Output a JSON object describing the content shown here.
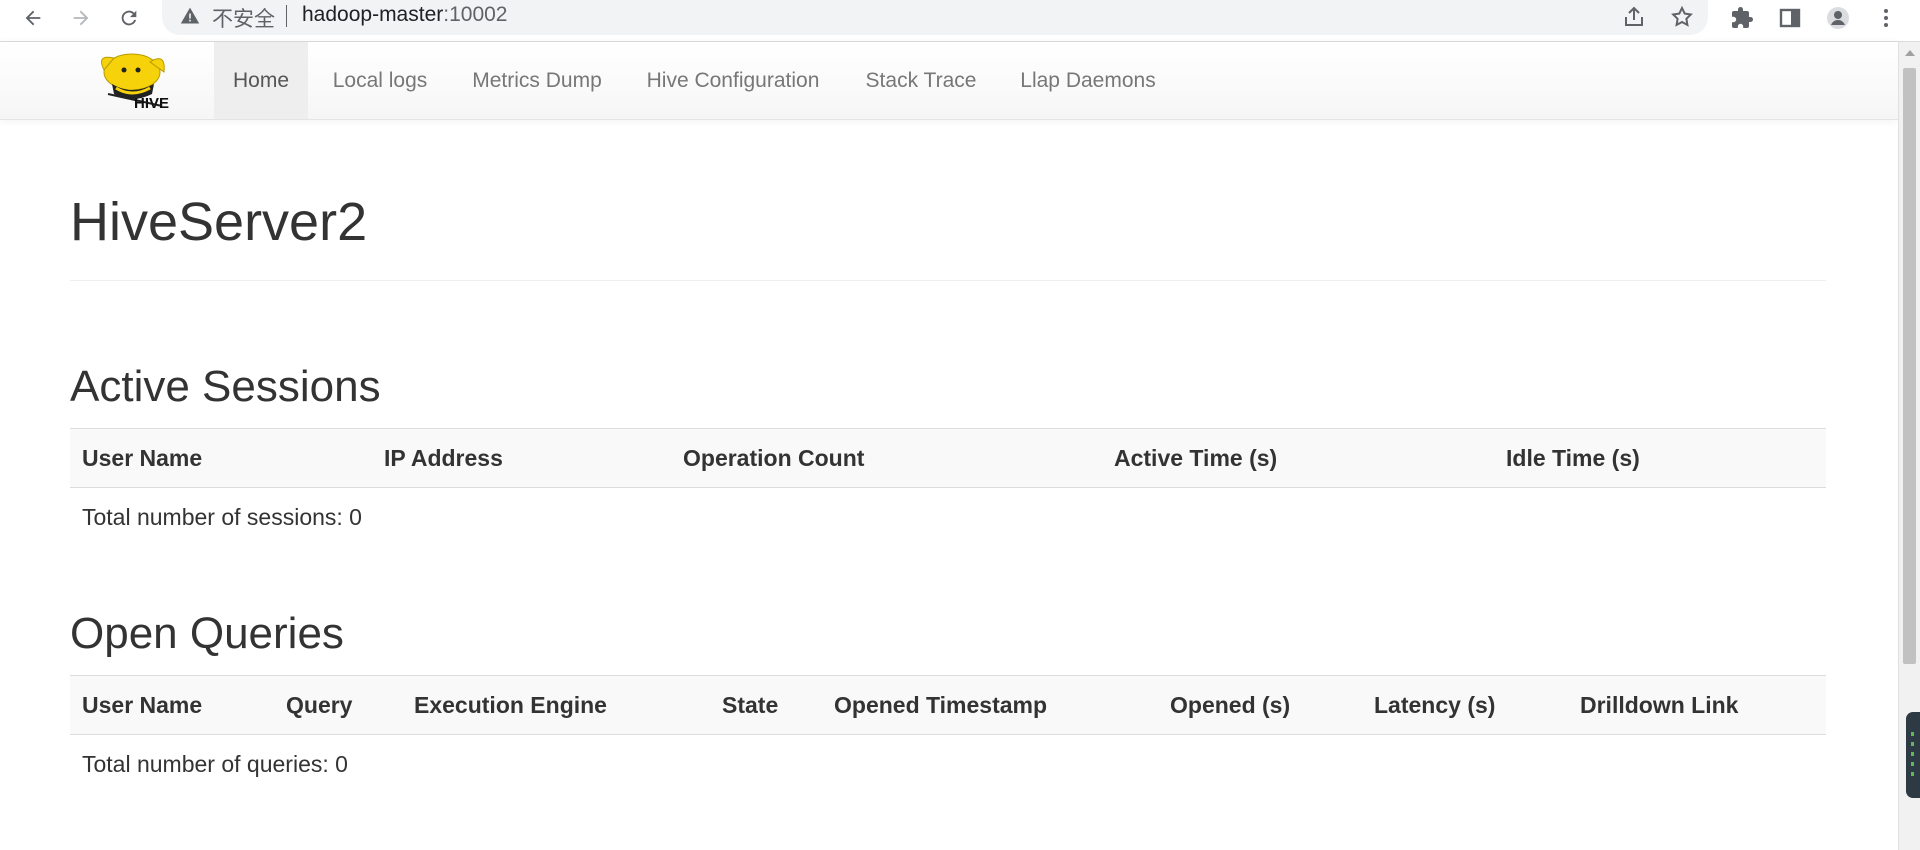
{
  "browser": {
    "insecure_label": "不安全",
    "url_host": "hadoop-master",
    "url_port": ":10002"
  },
  "navbar": {
    "logo_text": "HIVE",
    "items": [
      {
        "label": "Home",
        "active": true
      },
      {
        "label": "Local logs",
        "active": false
      },
      {
        "label": "Metrics Dump",
        "active": false
      },
      {
        "label": "Hive Configuration",
        "active": false
      },
      {
        "label": "Stack Trace",
        "active": false
      },
      {
        "label": "Llap Daemons",
        "active": false
      }
    ]
  },
  "page": {
    "title": "HiveServer2"
  },
  "active_sessions": {
    "title": "Active Sessions",
    "columns": [
      "User Name",
      "IP Address",
      "Operation Count",
      "Active Time (s)",
      "Idle Time (s)"
    ],
    "rows": [],
    "summary": "Total number of sessions: 0"
  },
  "open_queries": {
    "title": "Open Queries",
    "columns": [
      "User Name",
      "Query",
      "Execution Engine",
      "State",
      "Opened Timestamp",
      "Opened (s)",
      "Latency (s)",
      "Drilldown Link"
    ],
    "rows": [],
    "summary": "Total number of queries: 0"
  },
  "colors": {
    "logo_yellow": "#f5d20a",
    "nav_active_bg": "#eeeeee",
    "table_header_bg": "#f9f9f9"
  }
}
